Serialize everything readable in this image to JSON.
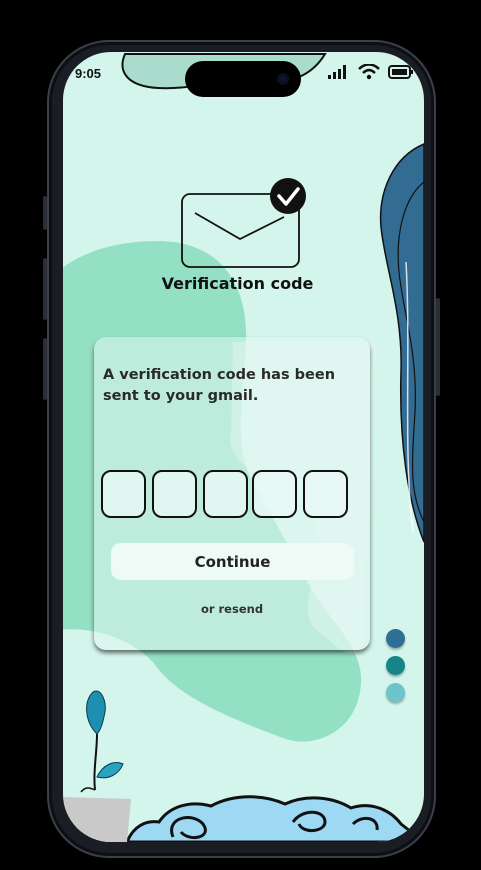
{
  "status_bar": {
    "time": "9:05"
  },
  "title": "Verification code",
  "card": {
    "message": "A verification code has been sent to your gmail.",
    "code_digits": [
      "",
      "",
      "",
      "",
      ""
    ],
    "continue_label": "Continue",
    "resend_label": "or resend"
  },
  "pager": {
    "colors": [
      "#2f6f96",
      "#16858a",
      "#6ec4cc"
    ]
  },
  "colors": {
    "background": "#d3f5eb",
    "blob_green": "#93e0c4",
    "wave_blue": "#336c93",
    "accent_check": "#111111"
  }
}
